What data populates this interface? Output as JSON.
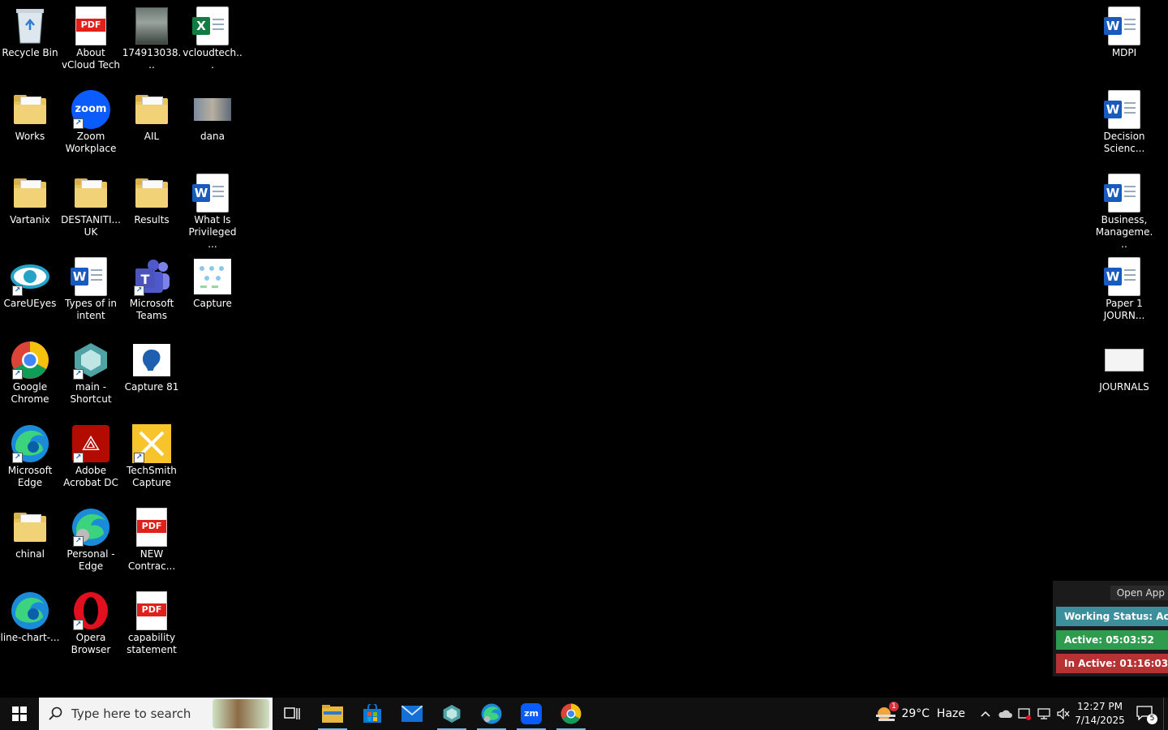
{
  "desktop": {
    "icons": [
      {
        "label": "Recycle Bin"
      },
      {
        "label": "About\nvCloud Tech"
      },
      {
        "label": "174913038..."
      },
      {
        "label": "vcloudtech..."
      },
      {
        "label": "Works"
      },
      {
        "label": "Zoom\nWorkplace"
      },
      {
        "label": "AIL"
      },
      {
        "label": "dana"
      },
      {
        "label": "Vartanix"
      },
      {
        "label": "DESTANITI...\nUK"
      },
      {
        "label": "Results"
      },
      {
        "label": "What Is\nPrivileged ..."
      },
      {
        "label": "CareUEyes"
      },
      {
        "label": "Types of in\nintent"
      },
      {
        "label": "Microsoft\nTeams"
      },
      {
        "label": "Capture"
      },
      {
        "label": "Google\nChrome"
      },
      {
        "label": "main -\nShortcut"
      },
      {
        "label": "Capture 81"
      },
      {
        "label": "Microsoft\nEdge"
      },
      {
        "label": "Adobe\nAcrobat DC"
      },
      {
        "label": "TechSmith\nCapture"
      },
      {
        "label": "chinal"
      },
      {
        "label": "Personal -\nEdge"
      },
      {
        "label": "NEW\nContrac..."
      },
      {
        "label": "line-chart-..."
      },
      {
        "label": "Opera\nBrowser"
      },
      {
        "label": "capability\nstatement"
      },
      {
        "label": "MDPI"
      },
      {
        "label": "Decision\nScienc..."
      },
      {
        "label": "Business,\nManageme..."
      },
      {
        "label": "Paper 1\nJOURN..."
      },
      {
        "label": "JOURNALS"
      }
    ]
  },
  "taskbar": {
    "search_placeholder": "Type here to search",
    "weather": "29°C  Haze",
    "weather_badge": "1",
    "time": "12:27 PM",
    "date": "7/14/2025",
    "notifications": "5"
  },
  "widget": {
    "open_app": "Open App",
    "working_status": "Working Status: Active",
    "active": "Active: 05:03:52",
    "inactive": "In Active: 01:16:03"
  },
  "colors": {
    "working": "#3d8f9c",
    "active": "#2e9b4f",
    "inactive": "#b73232"
  }
}
